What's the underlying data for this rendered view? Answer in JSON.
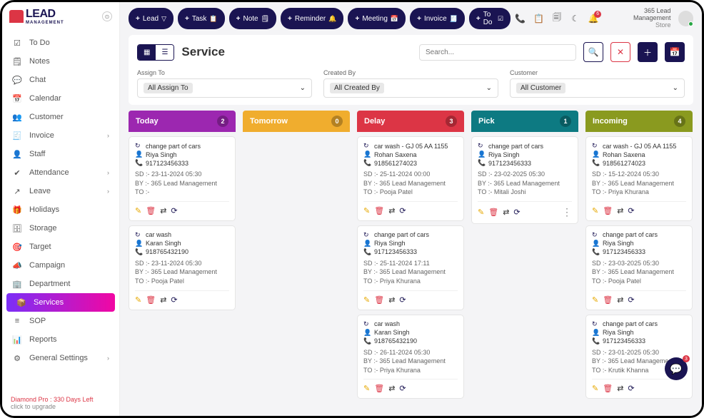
{
  "logo": {
    "main": "LEAD",
    "sub": "MANAGEMENT"
  },
  "sidebar": {
    "items": [
      {
        "icon": "☑",
        "label": "To Do",
        "chev": false
      },
      {
        "icon": "🗒",
        "label": "Notes",
        "chev": false
      },
      {
        "icon": "💬",
        "label": "Chat",
        "chev": false
      },
      {
        "icon": "📅",
        "label": "Calendar",
        "chev": false
      },
      {
        "icon": "👥",
        "label": "Customer",
        "chev": false
      },
      {
        "icon": "🧾",
        "label": "Invoice",
        "chev": true
      },
      {
        "icon": "👤",
        "label": "Staff",
        "chev": false
      },
      {
        "icon": "✔",
        "label": "Attendance",
        "chev": true
      },
      {
        "icon": "↗",
        "label": "Leave",
        "chev": true
      },
      {
        "icon": "🎁",
        "label": "Holidays",
        "chev": false
      },
      {
        "icon": "🗄",
        "label": "Storage",
        "chev": false
      },
      {
        "icon": "🎯",
        "label": "Target",
        "chev": false
      },
      {
        "icon": "📣",
        "label": "Campaign",
        "chev": false
      },
      {
        "icon": "🏢",
        "label": "Department",
        "chev": false
      },
      {
        "icon": "📦",
        "label": "Services",
        "chev": false,
        "active": true
      },
      {
        "icon": "≡",
        "label": "SOP",
        "chev": false
      },
      {
        "icon": "📊",
        "label": "Reports",
        "chev": false
      },
      {
        "icon": "⚙",
        "label": "General Settings",
        "chev": true
      }
    ],
    "plan": "Diamond Pro : 330 Days Left",
    "upgrade": "click to upgrade"
  },
  "topbar": {
    "buttons": [
      {
        "label": "Lead",
        "icon": "▽"
      },
      {
        "label": "Task",
        "icon": "📋"
      },
      {
        "label": "Note",
        "icon": "🗒"
      },
      {
        "label": "Reminder",
        "icon": "🔔"
      },
      {
        "label": "Meeting",
        "icon": "📅"
      },
      {
        "label": "Invoice",
        "icon": "🧾"
      },
      {
        "label": "To Do",
        "icon": "☑"
      }
    ],
    "notif_count": "6",
    "org_name": "365 Lead Management",
    "org_sub": "Store"
  },
  "page": {
    "title": "Service",
    "search_ph": "Search...",
    "filters": [
      {
        "label": "Assign To",
        "value": "All Assign To"
      },
      {
        "label": "Created By",
        "value": "All Created By"
      },
      {
        "label": "Customer",
        "value": "All Customer"
      }
    ]
  },
  "columns": [
    {
      "title": "Today",
      "count": "2",
      "color": "#9c27b0",
      "cards": [
        {
          "title": "change part of cars",
          "person": "Riya Singh",
          "phone": "917123456333",
          "sd": "23-11-2024 05:30",
          "by": "365 Lead Management",
          "to": ""
        },
        {
          "title": "car wash",
          "person": "Karan Singh",
          "phone": "918765432190",
          "sd": "23-11-2024 05:30",
          "by": "365 Lead Management",
          "to": "Pooja Patel"
        }
      ]
    },
    {
      "title": "Tomorrow",
      "count": "0",
      "color": "#f0ad2e",
      "cards": []
    },
    {
      "title": "Delay",
      "count": "3",
      "color": "#dc3545",
      "cards": [
        {
          "title": "car wash - GJ 05 AA 1155",
          "person": "Rohan Saxena",
          "phone": "918561274023",
          "sd": "25-11-2024 00:00",
          "by": "365 Lead Management",
          "to": "Pooja Patel"
        },
        {
          "title": "change part of cars",
          "person": "Riya Singh",
          "phone": "917123456333",
          "sd": "25-11-2024 17:11",
          "by": "365 Lead Management",
          "to": "Priya Khurana"
        },
        {
          "title": "car wash",
          "person": "Karan Singh",
          "phone": "918765432190",
          "sd": "26-11-2024 05:30",
          "by": "365 Lead Management",
          "to": "Priya Khurana"
        }
      ]
    },
    {
      "title": "Pick",
      "count": "1",
      "color": "#0d7a82",
      "cards": [
        {
          "title": "change part of cars",
          "person": "Riya Singh",
          "phone": "917123456333",
          "sd": "23-02-2025 05:30",
          "by": "365 Lead Management",
          "to": "Mitali Joshi",
          "more": true
        }
      ]
    },
    {
      "title": "Incoming",
      "count": "4",
      "color": "#8a9a1f",
      "cards": [
        {
          "title": "car wash - GJ 05 AA 1155",
          "person": "Rohan Saxena",
          "phone": "918561274023",
          "sd": "15-12-2024 05:30",
          "by": "365 Lead Management",
          "to": "Priya Khurana"
        },
        {
          "title": "change part of cars",
          "person": "Riya Singh",
          "phone": "917123456333",
          "sd": "23-03-2025 05:30",
          "by": "365 Lead Management",
          "to": "Pooja Patel"
        },
        {
          "title": "change part of cars",
          "person": "Riya Singh",
          "phone": "917123456333",
          "sd": "23-01-2025 05:30",
          "by": "365 Lead Management",
          "to": "Krutik Khanna"
        }
      ]
    }
  ],
  "fab_count": "3"
}
